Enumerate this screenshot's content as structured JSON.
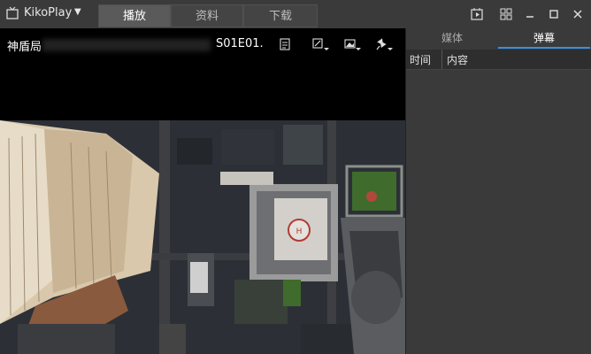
{
  "app": {
    "name": "KikoPlay",
    "icon": "tv-icon"
  },
  "tabs": [
    {
      "label": "播放",
      "active": true
    },
    {
      "label": "资料",
      "active": false
    },
    {
      "label": "下载",
      "active": false
    }
  ],
  "window_controls": [
    "play-list-icon",
    "grid-icon",
    "minimize-icon",
    "maximize-icon",
    "close-icon"
  ],
  "player": {
    "title_start": "神盾局",
    "title_end": "S01E01.",
    "controls": [
      "file-info-icon",
      "resize-icon",
      "screenshot-icon",
      "pin-icon"
    ]
  },
  "sidebar": {
    "tabs": [
      {
        "label": "媒体",
        "active": false
      },
      {
        "label": "弹幕",
        "active": true
      }
    ],
    "columns": {
      "time": "时间",
      "content": "内容"
    }
  },
  "colors": {
    "accent": "#3a8ee6",
    "titlebar": "#3a3a3a",
    "panel": "#3a3a3a"
  }
}
